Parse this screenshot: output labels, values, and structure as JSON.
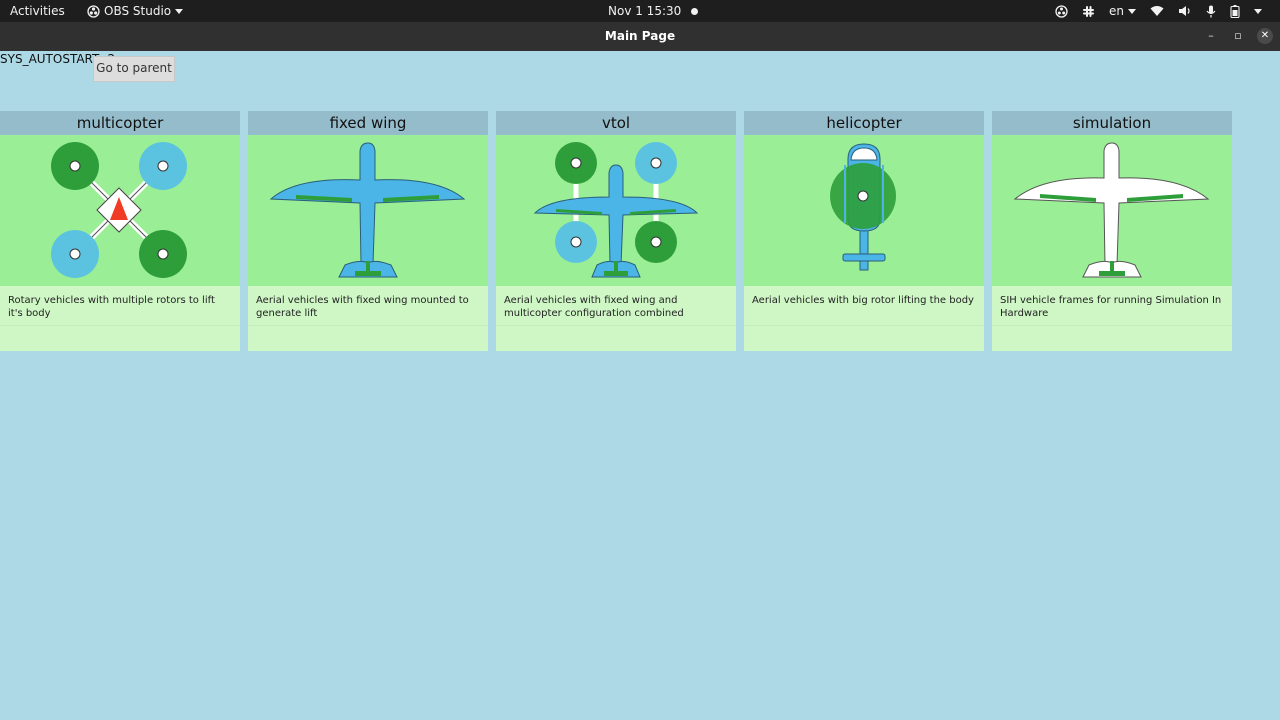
{
  "topbar": {
    "activities": "Activities",
    "app_name": "OBS Studio",
    "clock": "Nov 1  15:30",
    "language": "en",
    "icons": [
      "obs-tray-icon",
      "slack-icon",
      "wifi-icon",
      "volume-icon",
      "microphone-icon",
      "battery-icon",
      "power-icon"
    ]
  },
  "window": {
    "title": "Main Page",
    "minimize": "–",
    "maximize": "▫",
    "close": "✕"
  },
  "param_label": "SYS_AUTOSTART -2",
  "tooltip": "Go to parent",
  "colors": {
    "background": "#add8e6",
    "card_header": "#95bccb",
    "card_image_bg": "#9aee96",
    "card_desc_bg": "#cff7c6",
    "rotor_green": "#2e9e3a",
    "rotor_blue": "#5bc3df",
    "airframe_blue": "#4ab5e6"
  },
  "cards": [
    {
      "title": "multicopter",
      "description": "Rotary vehicles with multiple rotors to lift it's body",
      "icon": "multicopter-icon"
    },
    {
      "title": "fixed wing",
      "description": "Aerial vehicles with fixed wing mounted to generate lift",
      "icon": "fixed-wing-icon"
    },
    {
      "title": "vtol",
      "description": "Aerial vehicles with fixed wing and multicopter configuration combined",
      "icon": "vtol-icon"
    },
    {
      "title": "helicopter",
      "description": "Aerial vehicles with big rotor lifting the body",
      "icon": "helicopter-icon"
    },
    {
      "title": "simulation",
      "description": "SIH vehicle frames for running Simulation In Hardware",
      "icon": "simulation-icon"
    }
  ]
}
